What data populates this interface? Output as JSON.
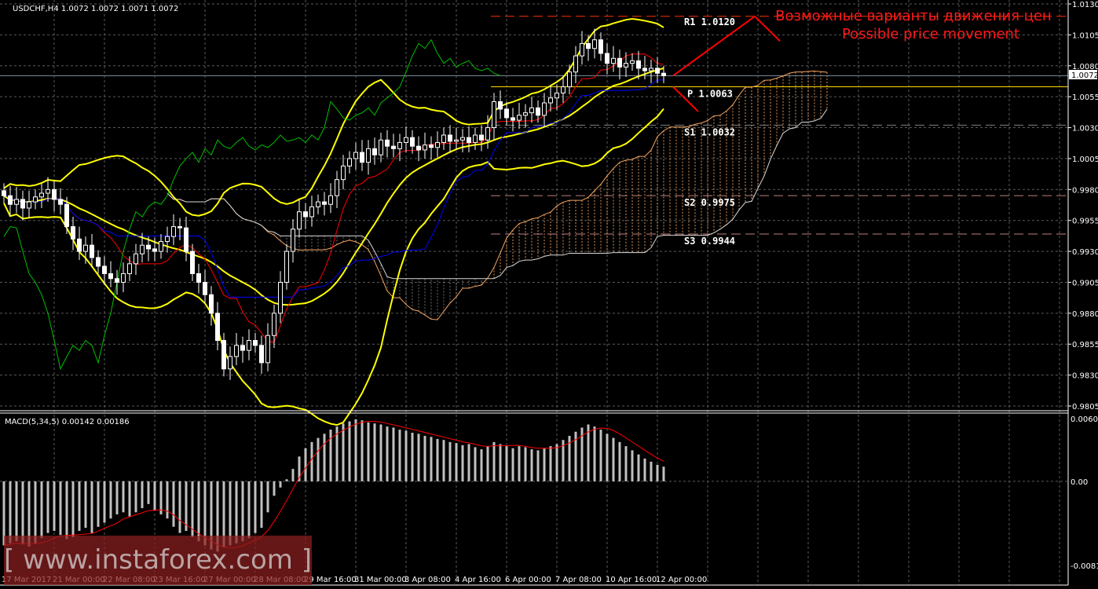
{
  "header": {
    "symbol_label": "USDCHF,H4  1.0072 1.0072 1.0071 1.0072"
  },
  "macd_label": "MACD(5,34,5) 0.00142 0.00186",
  "current_price_label": "1.0072",
  "annotation": {
    "line1": "Возможные варианты движения цен",
    "line2": "Possible price movement"
  },
  "watermark": "[ www.instaforex.com ]",
  "colors": {
    "background": "#000000",
    "bull": "#ffffff",
    "bear": "#ffffff",
    "bands": "#ffff00",
    "tenkan": "#ff0000",
    "kijun": "#0000ff",
    "chikou": "#00c000",
    "cloud": "#f4a460",
    "macd_hist": "#c0c0c0",
    "macd_signal": "#ff0000",
    "projection": "#ff0000"
  },
  "pivots": [
    {
      "label": "R1 1.0120",
      "value": 1.012,
      "color": "#ff3300"
    },
    {
      "label": "P 1.0063",
      "value": 1.0063,
      "color": "#ffd700"
    },
    {
      "label": "S1 1.0032",
      "value": 1.0032,
      "color": "#808080"
    },
    {
      "label": "S2 0.9975",
      "value": 0.9975,
      "color": "#c08080"
    },
    {
      "label": "S3 0.9944",
      "value": 0.9944,
      "color": "#c08080"
    }
  ],
  "chart_data": [
    {
      "type": "candlestick",
      "title": "USDCHF,H4",
      "ylim": [
        0.9805,
        1.013
      ],
      "yticks": [
        "1.0130",
        "1.0105",
        "1.0080",
        "1.0055",
        "1.0030",
        "1.0005",
        "0.9980",
        "0.9955",
        "0.9930",
        "0.9905",
        "0.9880",
        "0.9855",
        "0.9830",
        "0.9805"
      ],
      "xticks": [
        "17 Mar 2017",
        "21 Mar 00:00",
        "22 Mar 08:00",
        "23 Mar 16:00",
        "27 Mar 00:00",
        "28 Mar 08:00",
        "29 Mar 16:00",
        "31 Mar 00:00",
        "3 Apr 08:00",
        "4 Apr 16:00",
        "6 Apr 00:00",
        "7 Apr 08:00",
        "10 Apr 16:00",
        "12 Apr 00:00"
      ],
      "grid": true,
      "closes": [
        0.9975,
        0.9968,
        0.9972,
        0.9965,
        0.997,
        0.9974,
        0.9977,
        0.998,
        0.9972,
        0.9968,
        0.995,
        0.994,
        0.993,
        0.9935,
        0.9925,
        0.9918,
        0.9912,
        0.9908,
        0.9905,
        0.9912,
        0.992,
        0.9928,
        0.9935,
        0.9932,
        0.993,
        0.9938,
        0.9942,
        0.995,
        0.9949,
        0.993,
        0.9912,
        0.9905,
        0.9895,
        0.988,
        0.9858,
        0.9835,
        0.9845,
        0.9854,
        0.985,
        0.9858,
        0.9854,
        0.984,
        0.9862,
        0.988,
        0.9905,
        0.993,
        0.9948,
        0.9962,
        0.9958,
        0.9966,
        0.997,
        0.9968,
        0.9975,
        0.9988,
        0.9999,
        1.0005,
        1.001,
        1.0002,
        1.0013,
        1.0008,
        1.002,
        1.0015,
        1.0013,
        1.0018,
        1.0022,
        1.0015,
        1.0012,
        1.0016,
        1.0014,
        1.0018,
        1.0024,
        1.0019,
        1.002,
        1.0022,
        1.0018,
        1.0024,
        1.002,
        1.003,
        1.0051,
        1.0045,
        1.0038,
        1.0036,
        1.004,
        1.0042,
        1.0046,
        1.004,
        1.005,
        1.0054,
        1.0058,
        1.0063,
        1.0075,
        1.0088,
        1.0098,
        1.0094,
        1.0101,
        1.009,
        1.0082,
        1.0086,
        1.0079,
        1.0082,
        1.0084,
        1.0078,
        1.0076,
        1.0078,
        1.0074,
        1.0072
      ],
      "current_price": 1.0072,
      "projection": [
        {
          "path": [
            [
              1.0072,
              0
            ],
            [
              1.012,
              13
            ],
            [
              1.01,
              17
            ]
          ]
        },
        {
          "path": [
            [
              1.0063,
              0
            ],
            [
              1.0043,
              4
            ]
          ]
        }
      ]
    },
    {
      "type": "bar",
      "title": "MACD(5,34,5)",
      "ylim": [
        -0.00814,
        0.00607
      ],
      "yticks": [
        "0.00607",
        "0.00",
        "-0.00814"
      ],
      "values": [
        -0.0062,
        -0.006,
        -0.0058,
        -0.0061,
        -0.0063,
        -0.006,
        -0.0055,
        -0.005,
        -0.0048,
        -0.0052,
        -0.0056,
        -0.0054,
        -0.0048,
        -0.0045,
        -0.005,
        -0.0044,
        -0.004,
        -0.0036,
        -0.0032,
        -0.003,
        -0.0034,
        -0.003,
        -0.0026,
        -0.0022,
        -0.0028,
        -0.0032,
        -0.0036,
        -0.0044,
        -0.005,
        -0.0048,
        -0.0054,
        -0.0058,
        -0.0062,
        -0.0066,
        -0.0068,
        -0.0064,
        -0.0062,
        -0.006,
        -0.0058,
        -0.0055,
        -0.005,
        -0.0045,
        -0.003,
        -0.0014,
        -0.0006,
        0.0002,
        0.0012,
        0.0024,
        0.0032,
        0.0038,
        0.0042,
        0.0046,
        0.005,
        0.0053,
        0.0056,
        0.0058,
        0.006,
        0.0059,
        0.0057,
        0.0056,
        0.0055,
        0.0053,
        0.0052,
        0.005,
        0.0049,
        0.0047,
        0.0046,
        0.0044,
        0.0043,
        0.0041,
        0.004,
        0.0038,
        0.0037,
        0.0035,
        0.0036,
        0.0033,
        0.0031,
        0.0034,
        0.0038,
        0.0036,
        0.0034,
        0.0032,
        0.0034,
        0.0033,
        0.0031,
        0.003,
        0.0032,
        0.0034,
        0.0036,
        0.004,
        0.0044,
        0.0048,
        0.0052,
        0.0055,
        0.0053,
        0.005,
        0.0046,
        0.0042,
        0.0038,
        0.0034,
        0.003,
        0.0026,
        0.0022,
        0.0019,
        0.0016,
        0.00142
      ]
    }
  ]
}
